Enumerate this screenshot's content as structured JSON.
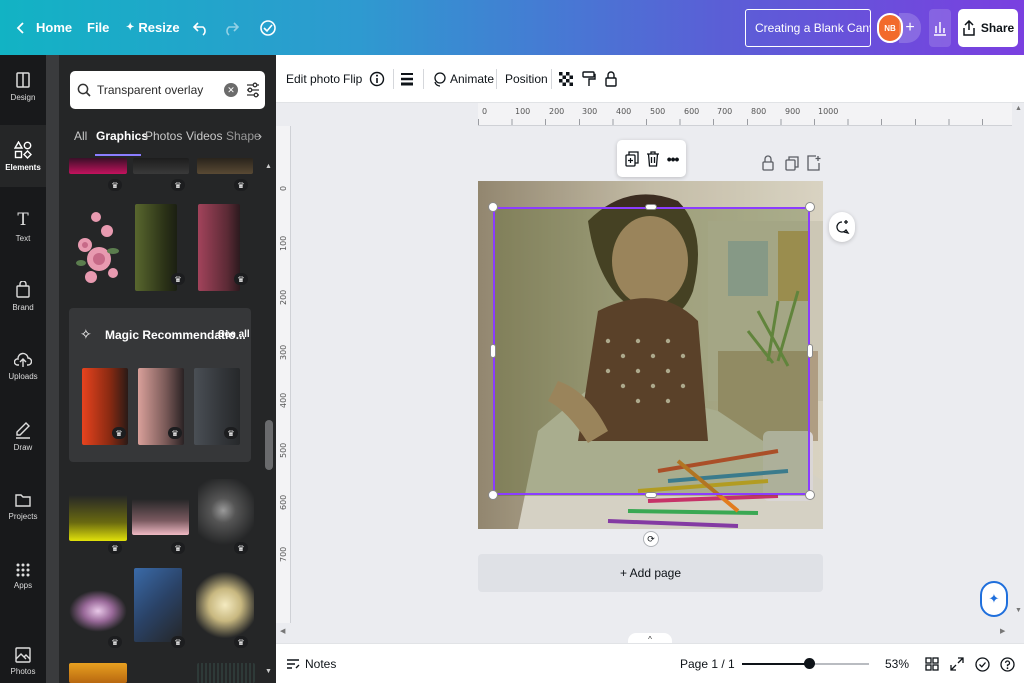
{
  "topbar": {
    "home_label": "Home",
    "file_label": "File",
    "resize_label": "Resize",
    "design_title": "Creating a Blank Canvas",
    "avatar_initials": "NB",
    "share_label": "Share"
  },
  "rail": {
    "items": [
      {
        "label": "Design",
        "icon": "design-icon"
      },
      {
        "label": "Elements",
        "icon": "elements-icon"
      },
      {
        "label": "Text",
        "icon": "text-icon"
      },
      {
        "label": "Brand",
        "icon": "brand-icon"
      },
      {
        "label": "Uploads",
        "icon": "uploads-icon"
      },
      {
        "label": "Draw",
        "icon": "draw-icon"
      },
      {
        "label": "Projects",
        "icon": "projects-icon"
      },
      {
        "label": "Apps",
        "icon": "apps-icon"
      },
      {
        "label": "Photos",
        "icon": "photos-icon"
      }
    ]
  },
  "panel": {
    "search_value": "Transparent overlay",
    "tabs": [
      "All",
      "Graphics",
      "Photos",
      "Videos",
      "Shape"
    ],
    "active_tab": "Graphics",
    "magic_title": "Magic Recommendatio...",
    "see_all": "See all"
  },
  "context_toolbar": {
    "edit_photo": "Edit photo",
    "flip": "Flip",
    "animate": "Animate",
    "position": "Position"
  },
  "ruler": {
    "top_ticks": [
      "0",
      "100",
      "200",
      "300",
      "400",
      "500",
      "600",
      "700",
      "800",
      "900",
      "1000"
    ],
    "left_ticks": [
      "0",
      "100",
      "200",
      "300",
      "400",
      "500",
      "600",
      "700"
    ]
  },
  "canvas": {
    "add_page": "+ Add page"
  },
  "bottombar": {
    "notes": "Notes",
    "page_indicator": "Page 1 / 1",
    "zoom": "53%",
    "zoom_level": 0.53
  },
  "colors": {
    "accent": "#8b3dff",
    "topbar_start": "#12b3c4",
    "topbar_end": "#7a3fe0",
    "panel_bg": "#252627"
  }
}
